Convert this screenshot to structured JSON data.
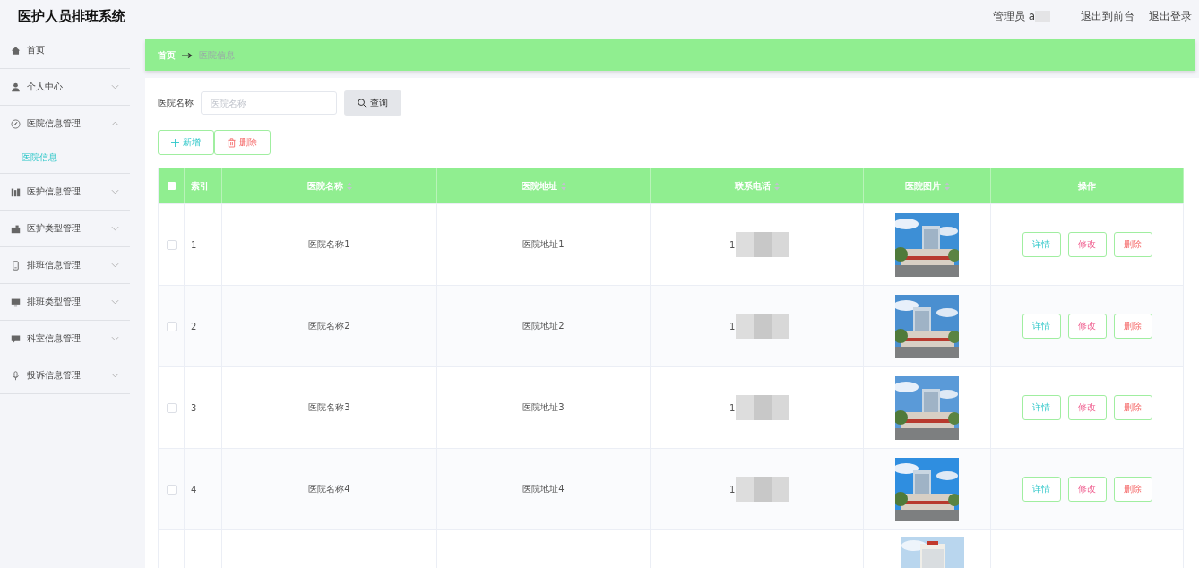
{
  "header": {
    "title": "医护人员排班系统",
    "user": "管理员 a",
    "links": [
      "退出到前台",
      "退出登录"
    ]
  },
  "sidebar": {
    "items": [
      {
        "label": "首页",
        "kind": "link"
      },
      {
        "label": "个人中心",
        "kind": "menu",
        "expanded": false
      },
      {
        "label": "医院信息管理",
        "kind": "menu",
        "expanded": true,
        "children": [
          {
            "label": "医院信息",
            "selected": true
          }
        ]
      },
      {
        "label": "医护信息管理",
        "kind": "menu",
        "expanded": false
      },
      {
        "label": "医护类型管理",
        "kind": "menu",
        "expanded": false
      },
      {
        "label": "排班信息管理",
        "kind": "menu",
        "expanded": false
      },
      {
        "label": "排班类型管理",
        "kind": "menu",
        "expanded": false
      },
      {
        "label": "科室信息管理",
        "kind": "menu",
        "expanded": false
      },
      {
        "label": "投诉信息管理",
        "kind": "menu",
        "expanded": false
      }
    ]
  },
  "breadcrumb": [
    "首页",
    "医院信息"
  ],
  "search": {
    "label": "医院名称",
    "placeholder": "医院名称",
    "button": "查询"
  },
  "actions": [
    "新增",
    "删除"
  ],
  "table": {
    "select_all_checked": false,
    "columns": [
      {
        "label": "索引",
        "sortable": false
      },
      {
        "label": "医院名称",
        "sortable": true
      },
      {
        "label": "医院地址",
        "sortable": true
      },
      {
        "label": "联系电话",
        "sortable": true
      },
      {
        "label": "医院图片",
        "sortable": true
      },
      {
        "label": "操作",
        "sortable": false
      }
    ],
    "rows": [
      {
        "index": "1",
        "name": "医院名称1",
        "address": "医院地址1",
        "phone": "1",
        "checked": false,
        "picture": {
          "kind": "picture"
        },
        "buttons": [
          "详情",
          "修改",
          "删除"
        ]
      },
      {
        "index": "2",
        "name": "医院名称2",
        "address": "医院地址2",
        "phone": "1",
        "checked": false,
        "picture": {
          "kind": "picture"
        },
        "buttons": [
          "详情",
          "修改",
          "删除"
        ]
      },
      {
        "index": "3",
        "name": "医院名称3",
        "address": "医院地址3",
        "phone": "1",
        "checked": false,
        "picture": {
          "kind": "picture"
        },
        "buttons": [
          "详情",
          "修改",
          "删除"
        ]
      },
      {
        "index": "4",
        "name": "医院名称4",
        "address": "医院地址4",
        "phone": "1",
        "checked": false,
        "picture": {
          "kind": "picture"
        },
        "buttons": [
          "详情",
          "修改",
          "删除"
        ]
      }
    ],
    "partial_row": {
      "picture": {
        "kind": "picture"
      }
    }
  }
}
